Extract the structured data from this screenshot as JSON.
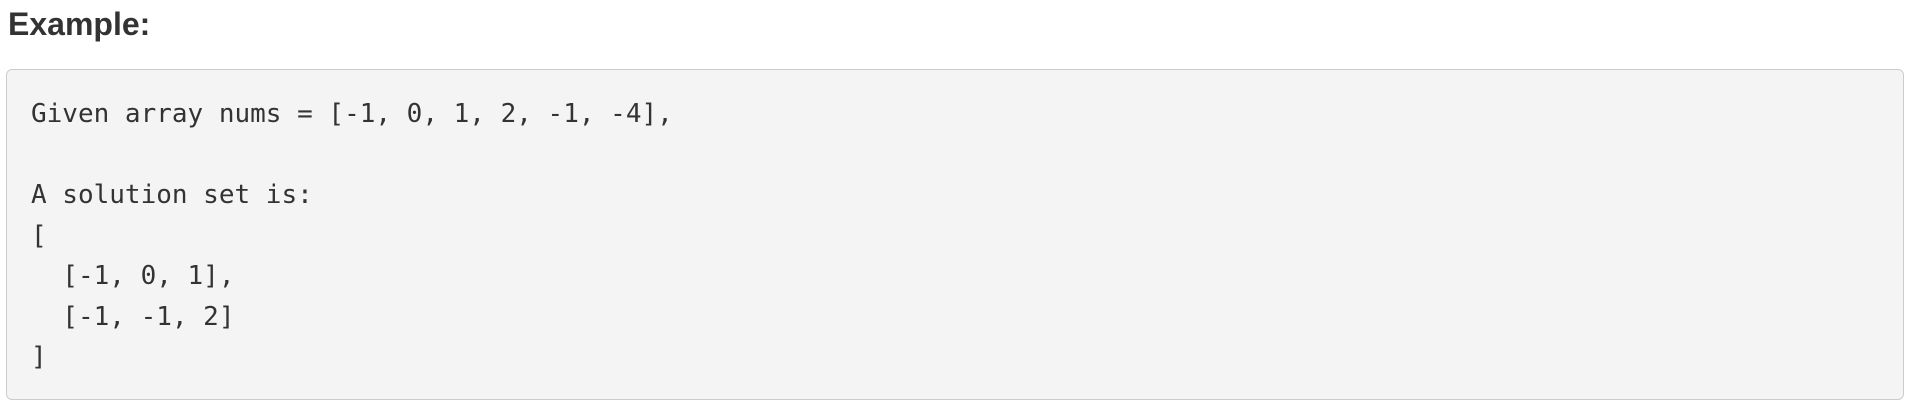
{
  "section": {
    "heading": "Example:"
  },
  "code_block": {
    "lines": [
      "Given array nums = [-1, 0, 1, 2, -1, -4],",
      "",
      "A solution set is:",
      "[",
      "  [-1, 0, 1],",
      "  [-1, -1, 2]",
      "]"
    ]
  }
}
